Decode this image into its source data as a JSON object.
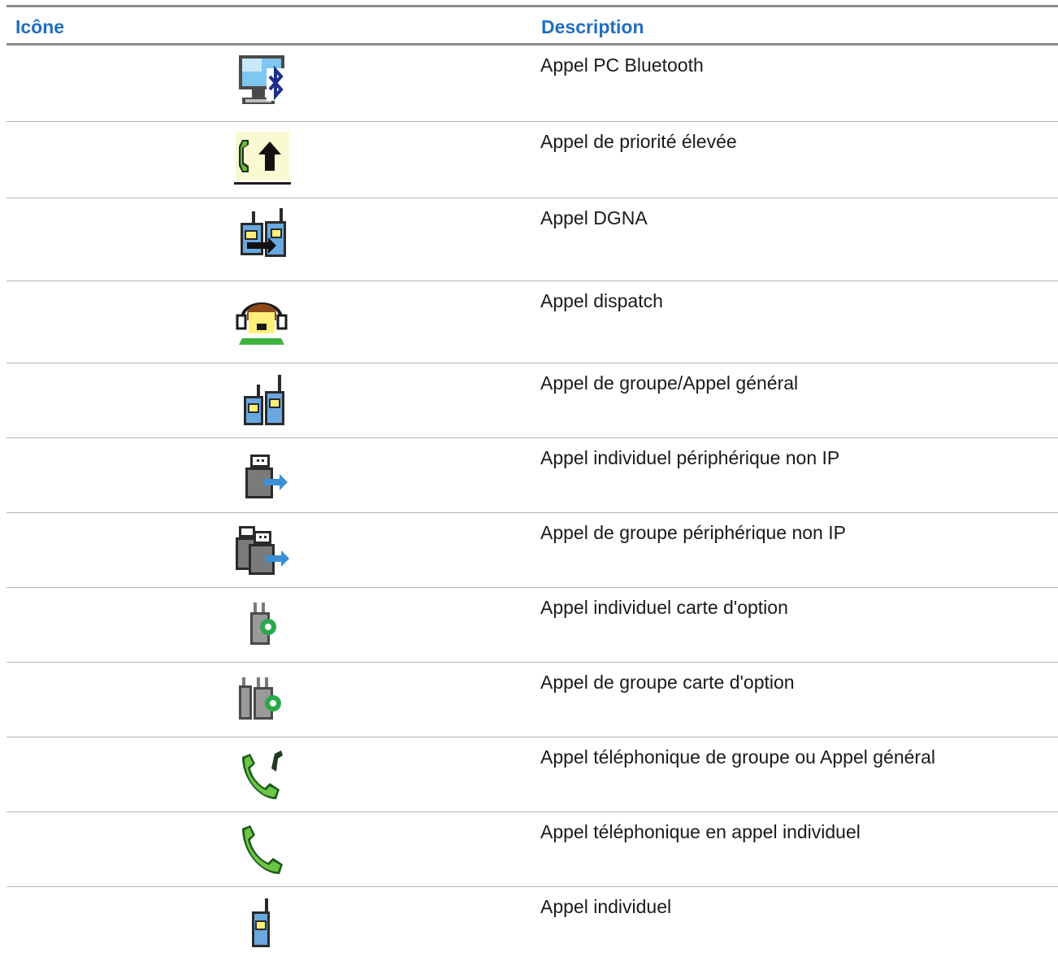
{
  "table": {
    "headers": {
      "icon": "Icône",
      "description": "Description"
    },
    "rows": [
      {
        "icon": "bluetooth-pc-call-icon",
        "description": "Appel PC Bluetooth"
      },
      {
        "icon": "high-priority-call-icon",
        "description": "Appel de priorité élevée"
      },
      {
        "icon": "dgna-call-icon",
        "description": "Appel DGNA"
      },
      {
        "icon": "dispatch-call-icon",
        "description": "Appel dispatch"
      },
      {
        "icon": "group-call-icon",
        "description": "Appel de groupe/Appel général"
      },
      {
        "icon": "non-ip-peripheral-private-call-icon",
        "description": "Appel individuel périphérique non IP"
      },
      {
        "icon": "non-ip-peripheral-group-call-icon",
        "description": "Appel de groupe périphérique non IP"
      },
      {
        "icon": "option-board-private-call-icon",
        "description": "Appel individuel carte d'option"
      },
      {
        "icon": "option-board-group-call-icon",
        "description": "Appel de groupe carte d'option"
      },
      {
        "icon": "phone-group-call-icon",
        "description": "Appel téléphonique de groupe ou Appel général"
      },
      {
        "icon": "phone-private-call-icon",
        "description": "Appel téléphonique en appel individuel"
      },
      {
        "icon": "private-call-icon",
        "description": "Appel individuel"
      }
    ]
  }
}
